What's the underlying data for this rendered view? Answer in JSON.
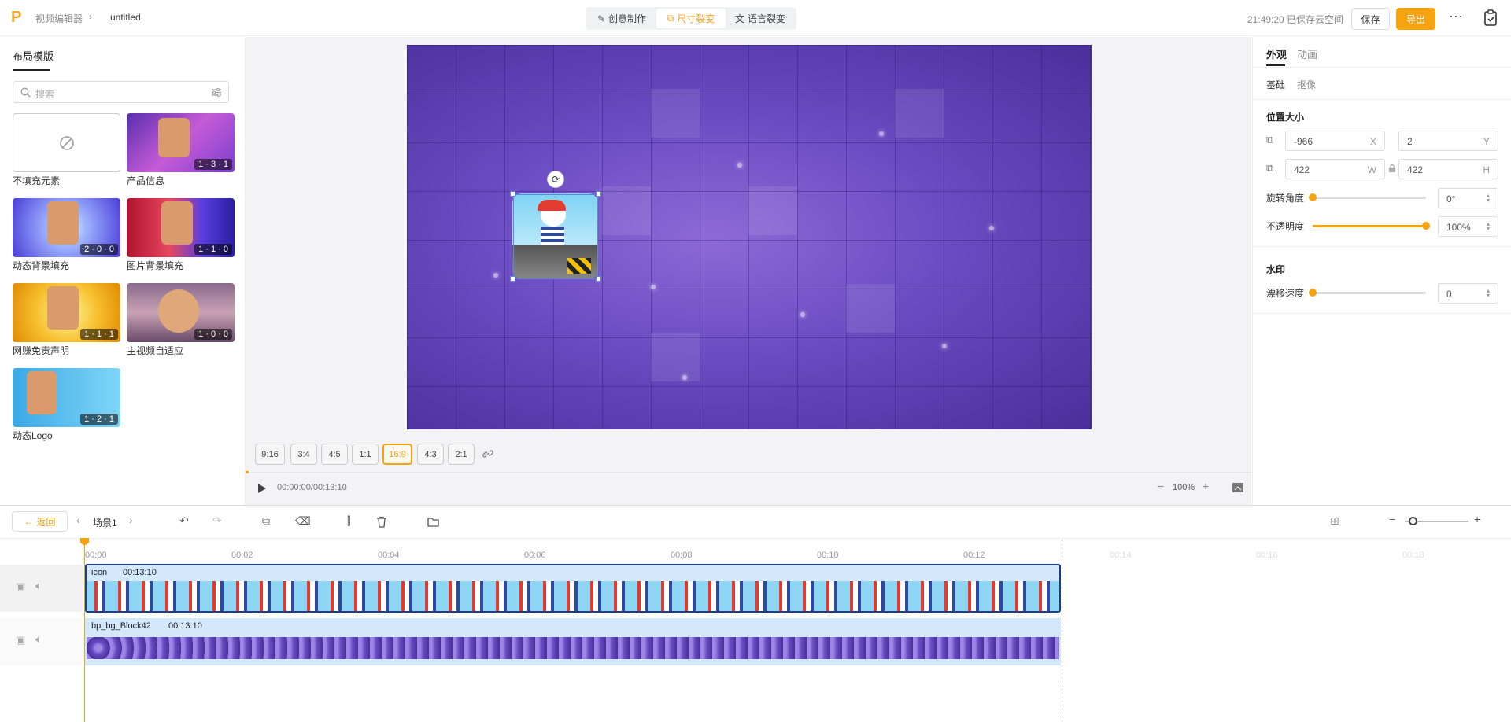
{
  "header": {
    "breadcrumb": [
      "视频编辑器",
      "untitled"
    ],
    "mode_tabs": [
      "创意制作",
      "尺寸裂变",
      "语言裂变"
    ],
    "active_mode": "尺寸裂变",
    "save_status": "21:49:20 已保存云空间",
    "save_label": "保存",
    "export_label": "导出"
  },
  "left_panel": {
    "title": "布局模版",
    "search_placeholder": "搜索",
    "templates": [
      {
        "name": "不填充元素",
        "badge": ""
      },
      {
        "name": "产品信息",
        "badge": "1 · 3 · 1"
      },
      {
        "name": "动态背景填充",
        "badge": "2 · 0 · 0"
      },
      {
        "name": "图片背景填充",
        "badge": "1 · 1 · 0"
      },
      {
        "name": "网赚免责声明",
        "badge": "1 · 1 · 1"
      },
      {
        "name": "主视频自适应",
        "badge": "1 · 0 · 0"
      },
      {
        "name": "动态Logo",
        "badge": "1 · 2 · 1"
      }
    ]
  },
  "stage": {
    "ratios": [
      "9:16",
      "3:4",
      "4:5",
      "1:1",
      "16:9",
      "4:3",
      "2:1"
    ],
    "active_ratio": "16:9",
    "time": "00:00:00/00:13:10",
    "zoom": "100%"
  },
  "right_panel": {
    "tabs": [
      "外观",
      "动画"
    ],
    "sub_tabs": [
      "基础",
      "抠像"
    ],
    "position_title": "位置大小",
    "x": "-966",
    "x_unit": "X",
    "y": "2",
    "y_unit": "Y",
    "w": "422",
    "w_unit": "W",
    "h": "422",
    "h_unit": "H",
    "rotation_label": "旋转角度",
    "rotation": "0°",
    "opacity_label": "不透明度",
    "opacity": "100%",
    "watermark_title": "水印",
    "drift_label": "漂移速度",
    "drift": "0"
  },
  "timeline": {
    "back_label": "返回",
    "scene": "场景1",
    "ticks": [
      "00:00",
      "00:02",
      "00:04",
      "00:06",
      "00:08",
      "00:10",
      "00:12",
      "00:14",
      "00:16",
      "00:18"
    ],
    "tracks": [
      {
        "name": "icon",
        "duration": "00:13:10"
      },
      {
        "name": "bp_bg_Block42",
        "duration": "00:13:10"
      }
    ]
  }
}
